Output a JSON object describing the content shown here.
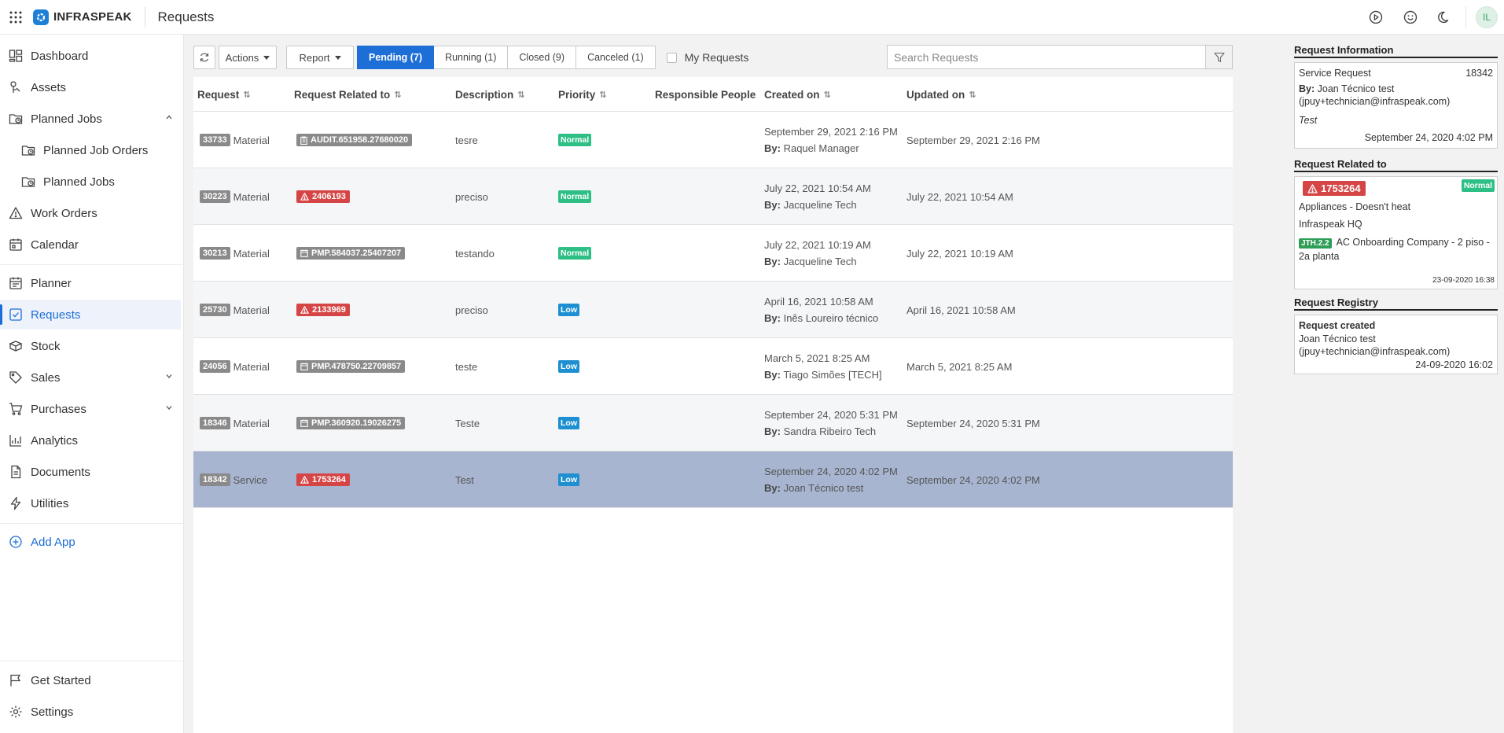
{
  "topbar": {
    "brand": "INFRASPEAK",
    "page_title": "Requests",
    "avatar_initials": "IL",
    "icons": [
      "apps-grid-icon",
      "play-circle-icon",
      "smiley-icon",
      "moon-icon"
    ]
  },
  "sidebar": {
    "items": [
      {
        "label": "Dashboard",
        "icon": "dashboard-icon"
      },
      {
        "label": "Assets",
        "icon": "asset-icon"
      },
      {
        "label": "Planned Jobs",
        "icon": "planned-jobs-icon"
      },
      {
        "label": "Planned Job Orders",
        "icon": "planned-job-orders-icon"
      },
      {
        "label": "Planned Jobs",
        "icon": "planned-jobs-sub-icon"
      },
      {
        "label": "Work Orders",
        "icon": "warning-triangle-icon"
      },
      {
        "label": "Calendar",
        "icon": "calendar-icon"
      },
      {
        "label": "Planner",
        "icon": "planner-icon"
      },
      {
        "label": "Requests",
        "icon": "requests-icon"
      },
      {
        "label": "Stock",
        "icon": "stock-icon"
      },
      {
        "label": "Sales",
        "icon": "tag-icon"
      },
      {
        "label": "Purchases",
        "icon": "cart-icon"
      },
      {
        "label": "Analytics",
        "icon": "chart-icon"
      },
      {
        "label": "Documents",
        "icon": "document-icon"
      },
      {
        "label": "Utilities",
        "icon": "bolt-icon"
      }
    ],
    "add_app": "Add App",
    "get_started": "Get Started",
    "settings": "Settings"
  },
  "toolbar": {
    "actions_label": "Actions",
    "report_label": "Report",
    "tabs": [
      {
        "label": "Pending (7)",
        "active": true
      },
      {
        "label": "Running (1)",
        "active": false
      },
      {
        "label": "Closed (9)",
        "active": false
      },
      {
        "label": "Canceled (1)",
        "active": false
      }
    ],
    "my_requests_label": "My Requests",
    "search_placeholder": "Search Requests"
  },
  "table": {
    "columns": [
      "Request",
      "Request Related to",
      "Description",
      "Priority",
      "Responsible People",
      "Created on",
      "Updated on"
    ],
    "by_label": "By:",
    "rows": [
      {
        "id": "33733",
        "type": "Material",
        "related": "AUDIT.651958.27680020",
        "related_style": "gray",
        "related_icon": "clipboard",
        "description": "tesre",
        "priority": "Normal",
        "responsible": "",
        "created": "September 29, 2021 2:16 PM",
        "created_by": "Raquel Manager",
        "updated": "September 29, 2021 2:16 PM"
      },
      {
        "id": "30223",
        "type": "Material",
        "related": "2406193",
        "related_style": "red",
        "related_icon": "warning",
        "description": "preciso",
        "priority": "Normal",
        "responsible": "",
        "created": "July 22, 2021 10:54 AM",
        "created_by": "Jacqueline Tech",
        "updated": "July 22, 2021 10:54 AM"
      },
      {
        "id": "30213",
        "type": "Material",
        "related": "PMP.584037.25407207",
        "related_style": "gray",
        "related_icon": "calendar",
        "description": "testando",
        "priority": "Normal",
        "responsible": "",
        "created": "July 22, 2021 10:19 AM",
        "created_by": "Jacqueline Tech",
        "updated": "July 22, 2021 10:19 AM"
      },
      {
        "id": "25730",
        "type": "Material",
        "related": "2133969",
        "related_style": "red",
        "related_icon": "warning",
        "description": "preciso",
        "priority": "Low",
        "responsible": "",
        "created": "April 16, 2021 10:58 AM",
        "created_by": "Inês Loureiro técnico",
        "updated": "April 16, 2021 10:58 AM"
      },
      {
        "id": "24056",
        "type": "Material",
        "related": "PMP.478750.22709857",
        "related_style": "gray",
        "related_icon": "calendar",
        "description": "teste",
        "priority": "Low",
        "responsible": "",
        "created": "March 5, 2021 8:25 AM",
        "created_by": "Tiago Simões [TECH]",
        "updated": "March 5, 2021 8:25 AM"
      },
      {
        "id": "18346",
        "type": "Material",
        "related": "PMP.360920.19026275",
        "related_style": "gray",
        "related_icon": "calendar",
        "description": "Teste",
        "priority": "Low",
        "responsible": "",
        "created": "September 24, 2020 5:31 PM",
        "created_by": "Sandra Ribeiro Tech",
        "updated": "September 24, 2020 5:31 PM"
      },
      {
        "id": "18342",
        "type": "Service",
        "related": "1753264",
        "related_style": "red",
        "related_icon": "warning",
        "description": "Test",
        "priority": "Low",
        "responsible": "",
        "created": "September 24, 2020 4:02 PM",
        "created_by": "Joan Técnico test",
        "updated": "September 24, 2020 4:02 PM",
        "selected": true
      }
    ]
  },
  "panel": {
    "info_title": "Request Information",
    "info_type": "Service Request",
    "info_id": "18342",
    "info_by_label": "By:",
    "info_by": "Joan Técnico test",
    "info_email": "(jpuy+technician@infraspeak.com)",
    "info_description": "Test",
    "info_date": "September 24, 2020 4:02 PM",
    "related_title": "Request Related to",
    "related_id": "1753264",
    "related_priority": "Normal",
    "related_problem": "Appliances - Doesn't heat",
    "related_client": "Infraspeak HQ",
    "related_tag": "JTH.2.2",
    "related_location": "AC Onboarding Company - 2 piso - 2a planta",
    "related_date": "23-09-2020 16:38",
    "registry_title": "Request Registry",
    "registry_event": "Request created",
    "registry_user": "Joan Técnico test",
    "registry_email": "(jpuy+technician@infraspeak.com)",
    "registry_date": "24-09-2020 16:02"
  },
  "colors": {
    "accent": "#1d6ed6",
    "normal": "#2dbf85",
    "low": "#1e8fd1",
    "danger": "#d64545",
    "selected_row": "#a7b5d0"
  }
}
